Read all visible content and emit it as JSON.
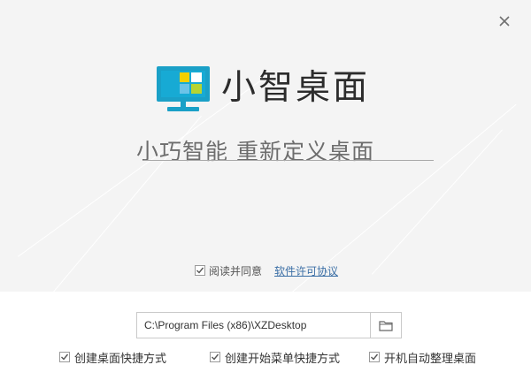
{
  "window": {
    "close_icon": "close-icon"
  },
  "brand": {
    "app_name": "小智桌面",
    "slogan": "小巧智能 重新定义桌面",
    "logo_icon": "monitor-logo-icon",
    "colors": {
      "monitor": "#1aa0c7",
      "tile_yellow": "#f5d000",
      "tile_blue": "#6cc3e8",
      "tile_green": "#b7d432",
      "tile_white": "#ffffff"
    }
  },
  "agreement": {
    "label": "阅读并同意",
    "link": "软件许可协议",
    "checked": true
  },
  "install": {
    "path_value": "C:\\Program Files (x86)\\XZDesktop",
    "browse_icon": "folder-icon"
  },
  "options": [
    {
      "label": "创建桌面快捷方式",
      "checked": true
    },
    {
      "label": "创建开始菜单快捷方式",
      "checked": true
    },
    {
      "label": "开机自动整理桌面",
      "checked": true
    }
  ]
}
